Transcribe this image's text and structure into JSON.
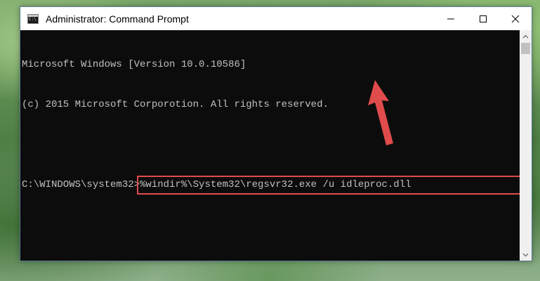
{
  "window": {
    "title": "Administrator: Command Prompt",
    "minimize_label": "─",
    "maximize_label": "☐",
    "close_label": "✕"
  },
  "console": {
    "lines": [
      "Microsoft Windows [Version 10.0.10586]",
      "(c) 2015 Microsoft Corporotion. All rights reserved.",
      ""
    ],
    "prompt": "C:\\WINDOWS\\system32>",
    "command": "%windir%\\System32\\regsvr32.exe /u idleproc.dll"
  },
  "colors": {
    "console_bg": "#0c0c0c",
    "console_text": "#c0c0c0",
    "highlight": "#e04b4b",
    "arrow": "#e04b4b"
  },
  "icons": {
    "app": "cmd-icon",
    "minimize": "minimize-icon",
    "maximize": "maximize-icon",
    "close": "close-icon",
    "scroll_up": "chevron-up-icon",
    "scroll_down": "chevron-down-icon",
    "annotation": "arrow-icon"
  }
}
